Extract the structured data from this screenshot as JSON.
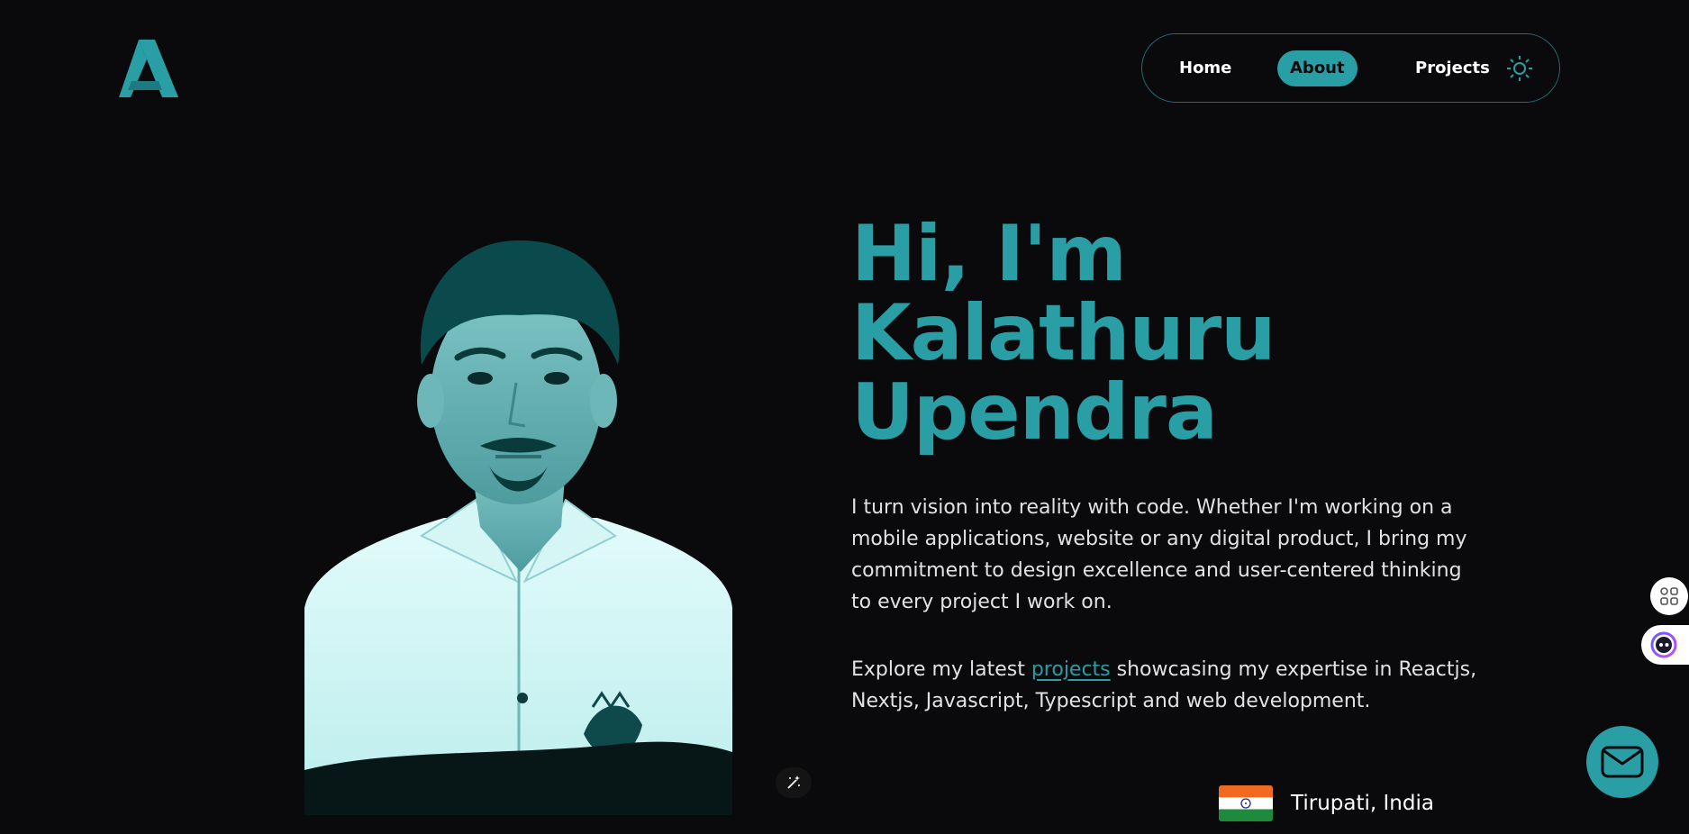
{
  "logo": {
    "icon": "a-logo-icon"
  },
  "nav": {
    "items": [
      {
        "label": "Home"
      },
      {
        "label": "About"
      },
      {
        "label": "Projects"
      }
    ],
    "active": "About",
    "theme_icon": "sun-icon"
  },
  "hero": {
    "title_lines": [
      "Hi, I'm",
      "Kalathuru",
      "Upendra"
    ],
    "para1": "I turn vision into reality with code. Whether I'm working on a mobile applications, website or any digital product, I bring my commitment to design excellence and user-centered thinking to every project I work on.",
    "para2_before": "Explore my latest ",
    "para2_link": "projects",
    "para2_after": " showcasing my expertise in Reactjs, Nextjs, Javascript, Typescript and web development."
  },
  "location": {
    "text": "Tirupati, India",
    "flag_icon": "india-flag-icon"
  },
  "colors": {
    "accent": "#2a9ea5",
    "background": "#0a0a0c",
    "text": "#e2e2e2"
  },
  "floating": {
    "apps_icon": "grid-icon",
    "assistant_icon": "assistant-face-icon",
    "mail_icon": "mail-icon",
    "magic_icon": "magic-wand-icon"
  }
}
